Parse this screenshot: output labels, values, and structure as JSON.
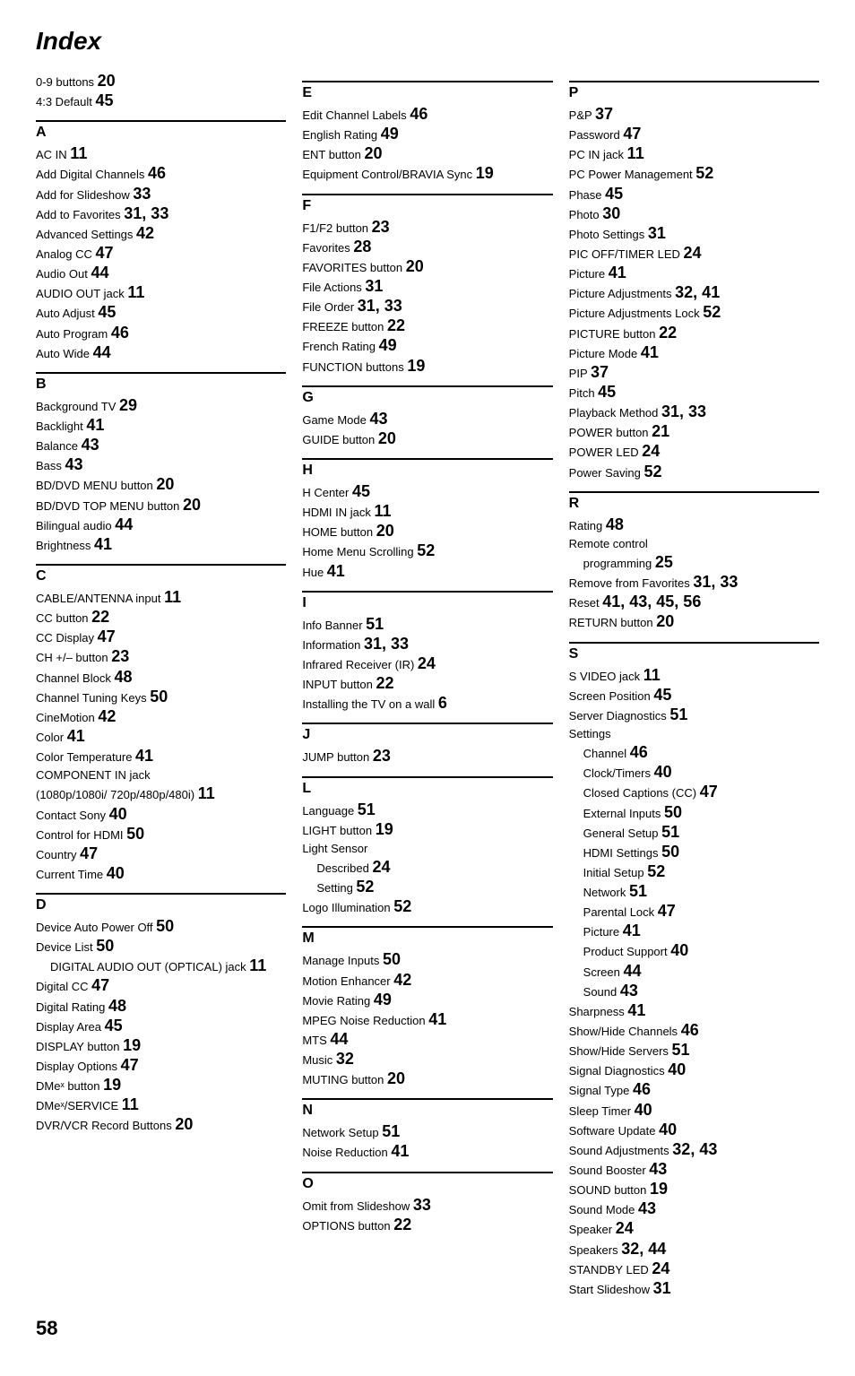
{
  "title": "Index",
  "pageNumber": "58",
  "columns": [
    {
      "id": "col1",
      "sections": [
        {
          "type": "pre",
          "entries": [
            {
              "text": "0-9 buttons",
              "num": "20"
            },
            {
              "text": "4:3 Default",
              "num": "45"
            }
          ]
        },
        {
          "letter": "A",
          "entries": [
            {
              "text": "AC IN",
              "num": "11"
            },
            {
              "text": "Add Digital Channels",
              "num": "46"
            },
            {
              "text": "Add for Slideshow",
              "num": "33"
            },
            {
              "text": "Add to Favorites",
              "num": "31, 33"
            },
            {
              "text": "Advanced Settings",
              "num": "42"
            },
            {
              "text": "Analog CC",
              "num": "47"
            },
            {
              "text": "Audio Out",
              "num": "44"
            },
            {
              "text": "AUDIO OUT jack",
              "num": "11"
            },
            {
              "text": "Auto Adjust",
              "num": "45"
            },
            {
              "text": "Auto Program",
              "num": "46"
            },
            {
              "text": "Auto Wide",
              "num": "44"
            }
          ]
        },
        {
          "letter": "B",
          "entries": [
            {
              "text": "Background TV",
              "num": "29"
            },
            {
              "text": "Backlight",
              "num": "41"
            },
            {
              "text": "Balance",
              "num": "43"
            },
            {
              "text": "Bass",
              "num": "43"
            },
            {
              "text": "BD/DVD MENU button",
              "num": "20"
            },
            {
              "text": "BD/DVD TOP MENU button",
              "num": "20"
            },
            {
              "text": "Bilingual audio",
              "num": "44"
            },
            {
              "text": "Brightness",
              "num": "41"
            }
          ]
        },
        {
          "letter": "C",
          "entries": [
            {
              "text": "CABLE/ANTENNA input",
              "num": "11"
            },
            {
              "text": "CC button",
              "num": "22"
            },
            {
              "text": "CC Display",
              "num": "47"
            },
            {
              "text": "CH +/– button",
              "num": "23"
            },
            {
              "text": "Channel Block",
              "num": "48"
            },
            {
              "text": "Channel Tuning Keys",
              "num": "50"
            },
            {
              "text": "CineMotion",
              "num": "42"
            },
            {
              "text": "Color",
              "num": "41"
            },
            {
              "text": "Color Temperature",
              "num": "41"
            },
            {
              "text": "COMPONENT IN jack (1080p/1080i/ 720p/480p/480i)",
              "num": "11"
            },
            {
              "text": "Contact Sony",
              "num": "40"
            },
            {
              "text": "Control for HDMI",
              "num": "50"
            },
            {
              "text": "Country",
              "num": "47"
            },
            {
              "text": "Current Time",
              "num": "40"
            }
          ]
        },
        {
          "letter": "D",
          "entries": [
            {
              "text": "Device Auto Power Off",
              "num": "50"
            },
            {
              "text": "Device List",
              "num": "50"
            },
            {
              "text": "DIGITAL AUDIO OUT (OPTICAL) jack",
              "num": "11",
              "sub": true
            },
            {
              "text": "Digital CC",
              "num": "47"
            },
            {
              "text": "Digital Rating",
              "num": "48"
            },
            {
              "text": "Display Area",
              "num": "45"
            },
            {
              "text": "DISPLAY button",
              "num": "19"
            },
            {
              "text": "Display Options",
              "num": "47"
            },
            {
              "text": "DMeˣ button",
              "num": "19"
            },
            {
              "text": "DMeˣ/SERVICE",
              "num": "11"
            },
            {
              "text": "DVR/VCR Record Buttons",
              "num": "20"
            }
          ]
        }
      ]
    },
    {
      "id": "col2",
      "sections": [
        {
          "letter": "E",
          "entries": [
            {
              "text": "Edit Channel Labels",
              "num": "46"
            },
            {
              "text": "English Rating",
              "num": "49"
            },
            {
              "text": "ENT button",
              "num": "20"
            },
            {
              "text": "Equipment Control/BRAVIA Sync",
              "num": "19"
            }
          ]
        },
        {
          "letter": "F",
          "entries": [
            {
              "text": "F1/F2 button",
              "num": "23"
            },
            {
              "text": "Favorites",
              "num": "28"
            },
            {
              "text": "FAVORITES button",
              "num": "20"
            },
            {
              "text": "File Actions",
              "num": "31"
            },
            {
              "text": "File Order",
              "num": "31, 33"
            },
            {
              "text": "FREEZE button",
              "num": "22"
            },
            {
              "text": "French Rating",
              "num": "49"
            },
            {
              "text": "FUNCTION buttons",
              "num": "19"
            }
          ]
        },
        {
          "letter": "G",
          "entries": [
            {
              "text": "Game Mode",
              "num": "43"
            },
            {
              "text": "GUIDE button",
              "num": "20"
            }
          ]
        },
        {
          "letter": "H",
          "entries": [
            {
              "text": "H Center",
              "num": "45"
            },
            {
              "text": "HDMI IN jack",
              "num": "11"
            },
            {
              "text": "HOME button",
              "num": "20"
            },
            {
              "text": "Home Menu Scrolling",
              "num": "52"
            },
            {
              "text": "Hue",
              "num": "41"
            }
          ]
        },
        {
          "letter": "I",
          "entries": [
            {
              "text": "Info Banner",
              "num": "51"
            },
            {
              "text": "Information",
              "num": "31, 33"
            },
            {
              "text": "Infrared Receiver (IR)",
              "num": "24"
            },
            {
              "text": "INPUT button",
              "num": "22"
            },
            {
              "text": "Installing the TV on a wall",
              "num": "6"
            }
          ]
        },
        {
          "letter": "J",
          "entries": [
            {
              "text": "JUMP button",
              "num": "23"
            }
          ]
        },
        {
          "letter": "L",
          "entries": [
            {
              "text": "Language",
              "num": "51"
            },
            {
              "text": "LIGHT button",
              "num": "19"
            },
            {
              "text": "Light Sensor",
              "num": ""
            },
            {
              "text": "Described",
              "num": "24",
              "sub": true
            },
            {
              "text": "Setting",
              "num": "52",
              "sub": true
            },
            {
              "text": "Logo Illumination",
              "num": "52"
            }
          ]
        },
        {
          "letter": "M",
          "entries": [
            {
              "text": "Manage Inputs",
              "num": "50"
            },
            {
              "text": "Motion Enhancer",
              "num": "42"
            },
            {
              "text": "Movie Rating",
              "num": "49"
            },
            {
              "text": "MPEG Noise Reduction",
              "num": "41"
            },
            {
              "text": "MTS",
              "num": "44"
            },
            {
              "text": "Music",
              "num": "32"
            },
            {
              "text": "MUTING button",
              "num": "20"
            }
          ]
        },
        {
          "letter": "N",
          "entries": [
            {
              "text": "Network Setup",
              "num": "51"
            },
            {
              "text": "Noise Reduction",
              "num": "41"
            }
          ]
        },
        {
          "letter": "O",
          "entries": [
            {
              "text": "Omit from Slideshow",
              "num": "33"
            },
            {
              "text": "OPTIONS button",
              "num": "22"
            }
          ]
        }
      ]
    },
    {
      "id": "col3",
      "sections": [
        {
          "letter": "P",
          "entries": [
            {
              "text": "P&P",
              "num": "37"
            },
            {
              "text": "Password",
              "num": "47"
            },
            {
              "text": "PC IN jack",
              "num": "11"
            },
            {
              "text": "PC Power Management",
              "num": "52"
            },
            {
              "text": "Phase",
              "num": "45"
            },
            {
              "text": "Photo",
              "num": "30"
            },
            {
              "text": "Photo Settings",
              "num": "31"
            },
            {
              "text": "PIC OFF/TIMER LED",
              "num": "24"
            },
            {
              "text": "Picture",
              "num": "41"
            },
            {
              "text": "Picture Adjustments",
              "num": "32, 41"
            },
            {
              "text": "Picture Adjustments Lock",
              "num": "52"
            },
            {
              "text": "PICTURE button",
              "num": "22"
            },
            {
              "text": "Picture Mode",
              "num": "41"
            },
            {
              "text": "PIP",
              "num": "37"
            },
            {
              "text": "Pitch",
              "num": "45"
            },
            {
              "text": "Playback Method",
              "num": "31, 33"
            },
            {
              "text": "POWER button",
              "num": "21"
            },
            {
              "text": "POWER LED",
              "num": "24"
            },
            {
              "text": "Power Saving",
              "num": "52"
            }
          ]
        },
        {
          "letter": "R",
          "entries": [
            {
              "text": "Rating",
              "num": "48"
            },
            {
              "text": "Remote control",
              "num": ""
            },
            {
              "text": "programming",
              "num": "25",
              "sub": true
            },
            {
              "text": "Remove from Favorites",
              "num": "31, 33"
            },
            {
              "text": "Reset",
              "num": "41, 43, 45, 56"
            },
            {
              "text": "RETURN button",
              "num": "20"
            }
          ]
        },
        {
          "letter": "S",
          "entries": [
            {
              "text": "S VIDEO jack",
              "num": "11"
            },
            {
              "text": "Screen Position",
              "num": "45"
            },
            {
              "text": "Server Diagnostics",
              "num": "51"
            },
            {
              "text": "Settings",
              "num": ""
            },
            {
              "text": "Channel",
              "num": "46",
              "sub": true
            },
            {
              "text": "Clock/Timers",
              "num": "40",
              "sub": true
            },
            {
              "text": "Closed Captions (CC)",
              "num": "47",
              "sub": true
            },
            {
              "text": "External Inputs",
              "num": "50",
              "sub": true
            },
            {
              "text": "General Setup",
              "num": "51",
              "sub": true
            },
            {
              "text": "HDMI Settings",
              "num": "50",
              "sub": true
            },
            {
              "text": "Initial Setup",
              "num": "52",
              "sub": true
            },
            {
              "text": "Network",
              "num": "51",
              "sub": true
            },
            {
              "text": "Parental Lock",
              "num": "47",
              "sub": true
            },
            {
              "text": "Picture",
              "num": "41",
              "sub": true
            },
            {
              "text": "Product Support",
              "num": "40",
              "sub": true
            },
            {
              "text": "Screen",
              "num": "44",
              "sub": true
            },
            {
              "text": "Sound",
              "num": "43",
              "sub": true
            },
            {
              "text": "Sharpness",
              "num": "41"
            },
            {
              "text": "Show/Hide Channels",
              "num": "46"
            },
            {
              "text": "Show/Hide Servers",
              "num": "51"
            },
            {
              "text": "Signal Diagnostics",
              "num": "40"
            },
            {
              "text": "Signal Type",
              "num": "46"
            },
            {
              "text": "Sleep Timer",
              "num": "40"
            },
            {
              "text": "Software Update",
              "num": "40"
            },
            {
              "text": "Sound Adjustments",
              "num": "32, 43"
            },
            {
              "text": "Sound Booster",
              "num": "43"
            },
            {
              "text": "SOUND button",
              "num": "19"
            },
            {
              "text": "Sound Mode",
              "num": "43"
            },
            {
              "text": "Speaker",
              "num": "24"
            },
            {
              "text": "Speakers",
              "num": "32, 44"
            },
            {
              "text": "STANDBY LED",
              "num": "24"
            },
            {
              "text": "Start Slideshow",
              "num": "31"
            }
          ]
        }
      ]
    }
  ]
}
